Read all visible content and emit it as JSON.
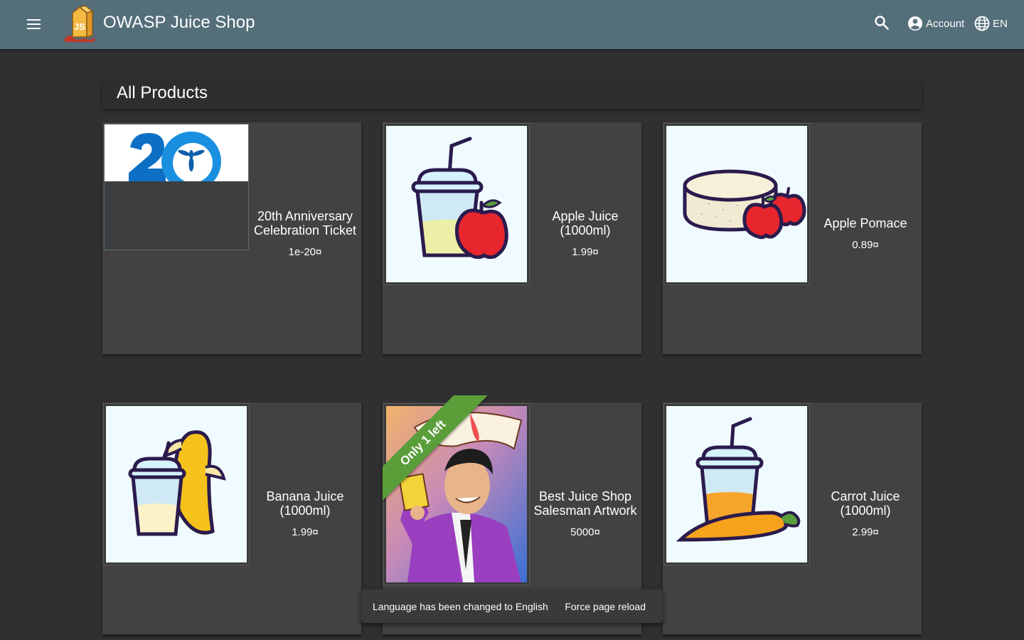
{
  "toolbar": {
    "menu_icon": "menu-icon",
    "logo_icon": "juice-shop-logo",
    "title": "OWASP Juice Shop",
    "search_icon": "search-icon",
    "account_label": "Account",
    "account_icon": "account-circle-icon",
    "language_label": "EN",
    "language_icon": "globe-icon",
    "colors": {
      "background": "#546e7a"
    }
  },
  "page": {
    "heading": "All Products",
    "background": "#303030",
    "card_background": "#424242"
  },
  "products": [
    {
      "name": "20th Anniversary Celebration Ticket",
      "price": "1e-20¤",
      "image_icon": "owasp-20-logo"
    },
    {
      "name": "Apple Juice (1000ml)",
      "price": "1.99¤",
      "image_icon": "apple-juice-icon"
    },
    {
      "name": "Apple Pomace",
      "price": "0.89¤",
      "image_icon": "apple-pomace-icon"
    },
    {
      "name": "Banana Juice (1000ml)",
      "price": "1.99¤",
      "image_icon": "banana-juice-icon"
    },
    {
      "name": "Best Juice Shop Salesman Artwork",
      "price": "5000¤",
      "image_icon": "salesman-artwork",
      "ribbon": "Only 1 left",
      "ribbon_color": "#5a9e3a"
    },
    {
      "name": "Carrot Juice (1000ml)",
      "price": "2.99¤",
      "image_icon": "carrot-juice-icon"
    }
  ],
  "snackbar": {
    "message": "Language has been changed to English",
    "action": "Force page reload"
  }
}
